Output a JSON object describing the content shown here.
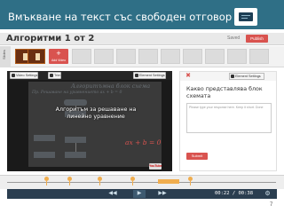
{
  "slide": {
    "title": "Вмъкване на текст със свободен отговор",
    "page_number": "7",
    "header_icon": "keyboard-icon"
  },
  "editor": {
    "title": "Алгоритми 1 от 2",
    "saved_label": "Saved",
    "publish_label": "Publish",
    "slides_tab": "Slides",
    "add_slide_label": "Add Video"
  },
  "video": {
    "settings_label": "Video Settings",
    "trim_label": "Trim",
    "element_settings_label": "Element Settings",
    "overlay_text": "Алгоритъм за решаване на линейно уравнение",
    "background_title": "Алгоритъмна блок схема",
    "background_subtitle": "Пр. Решаване на уравнението    ax + b = 0",
    "equation": "ax + b = 0",
    "youtube_label": "YouTube"
  },
  "question_panel": {
    "element_settings_label": "Element Settings",
    "question_text": "Какво представлява блок схемата",
    "answer_placeholder": "Please type your response here. Keep it short. Done",
    "submit_label": "Submit"
  },
  "player": {
    "time_readout": "00:22 / 00:38",
    "progress": 0.58
  },
  "colors": {
    "header_bg": "#2f6f86",
    "accent": "#d9534f",
    "timeline_marker": "#f0ad4e",
    "player_bg": "#2b3e50"
  }
}
